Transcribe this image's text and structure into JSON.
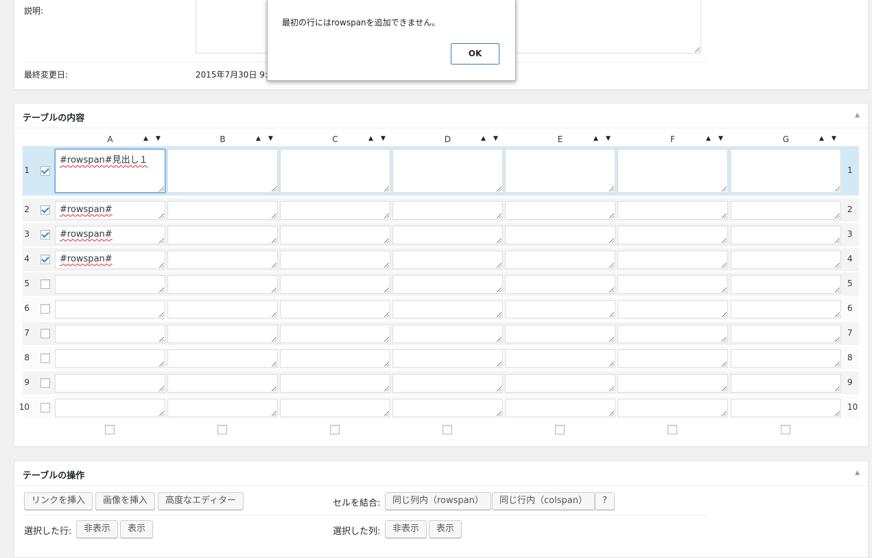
{
  "properties": {
    "description_label": "説明:",
    "description_value": "",
    "last_modified_label": "最終変更日:",
    "last_modified_value": "2015年7月30日 9:"
  },
  "dialog": {
    "message": "最初の行にはrowspanを追加できません。",
    "ok_label": "OK"
  },
  "table_content": {
    "title": "テーブルの内容",
    "columns": [
      "A",
      "B",
      "C",
      "D",
      "E",
      "F",
      "G"
    ],
    "sort_up": "▲",
    "sort_down": "▼",
    "toggle": "▲",
    "rows": [
      {
        "num": "1",
        "checked": true,
        "cells": [
          "#rowspan#見出し１",
          "",
          "",
          "",
          "",
          "",
          ""
        ]
      },
      {
        "num": "2",
        "checked": true,
        "cells": [
          "#rowspan#",
          "",
          "",
          "",
          "",
          "",
          ""
        ]
      },
      {
        "num": "3",
        "checked": true,
        "cells": [
          "#rowspan#",
          "",
          "",
          "",
          "",
          "",
          ""
        ]
      },
      {
        "num": "4",
        "checked": true,
        "cells": [
          "#rowspan#",
          "",
          "",
          "",
          "",
          "",
          ""
        ]
      },
      {
        "num": "5",
        "checked": false,
        "cells": [
          "",
          "",
          "",
          "",
          "",
          "",
          ""
        ]
      },
      {
        "num": "6",
        "checked": false,
        "cells": [
          "",
          "",
          "",
          "",
          "",
          "",
          ""
        ]
      },
      {
        "num": "7",
        "checked": false,
        "cells": [
          "",
          "",
          "",
          "",
          "",
          "",
          ""
        ]
      },
      {
        "num": "8",
        "checked": false,
        "cells": [
          "",
          "",
          "",
          "",
          "",
          "",
          ""
        ]
      },
      {
        "num": "9",
        "checked": false,
        "cells": [
          "",
          "",
          "",
          "",
          "",
          "",
          ""
        ]
      },
      {
        "num": "10",
        "checked": false,
        "cells": [
          "",
          "",
          "",
          "",
          "",
          "",
          ""
        ]
      }
    ]
  },
  "table_ops": {
    "title": "テーブルの操作",
    "toggle": "▲",
    "insert_link": "リンクを挿入",
    "insert_image": "画像を挿入",
    "advanced_editor": "高度なエディター",
    "merge_label": "セルを結合:",
    "same_column": "同じ列内（rowspan）",
    "same_row": "同じ行内（colspan）",
    "help": "?",
    "selected_rows_label": "選択した行:",
    "selected_cols_label": "選択した列:",
    "hide": "非表示",
    "show": "表示"
  }
}
